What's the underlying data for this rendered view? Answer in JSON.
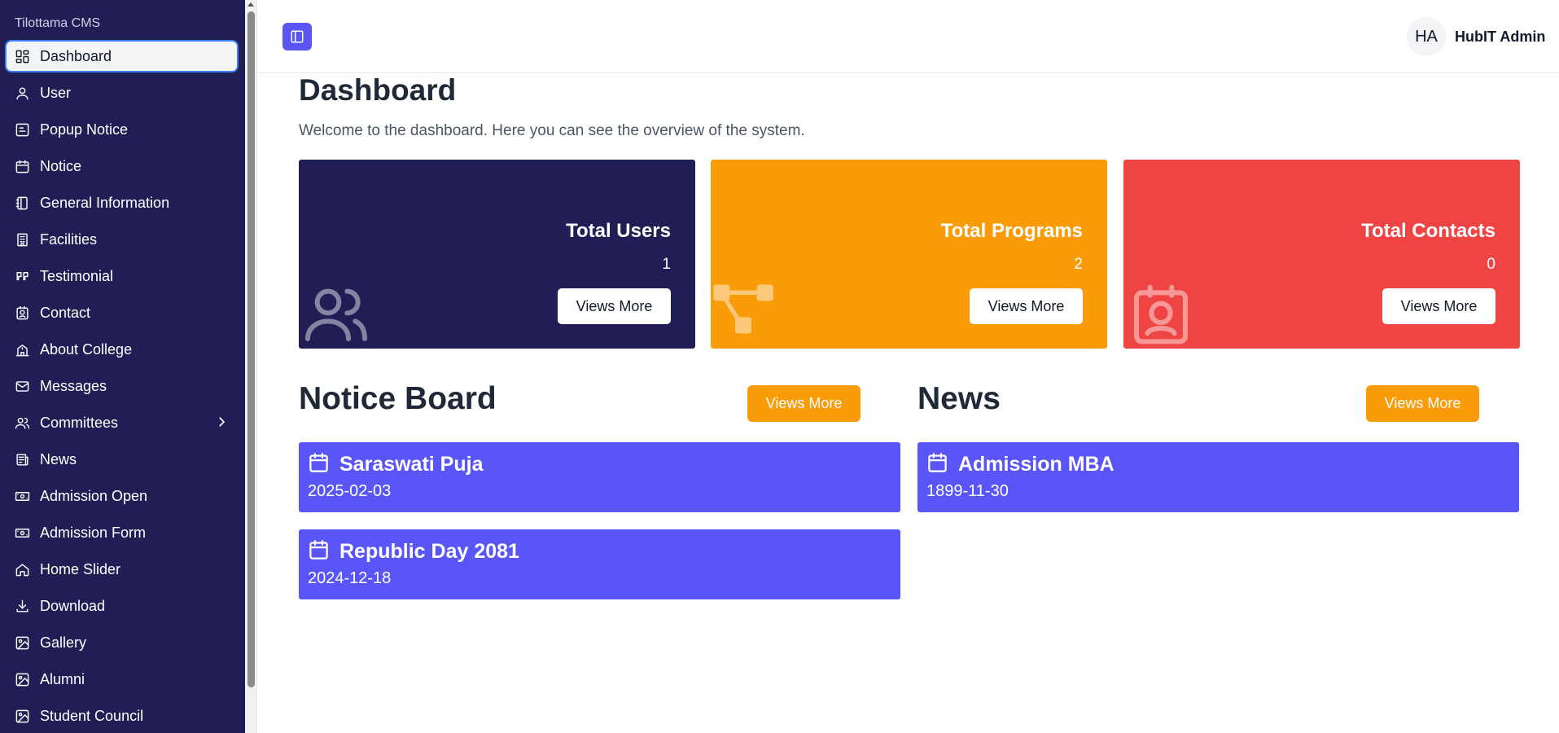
{
  "brand": "Tilottama CMS",
  "sidebar": {
    "items": [
      {
        "label": "Dashboard"
      },
      {
        "label": "User"
      },
      {
        "label": "Popup Notice"
      },
      {
        "label": "Notice"
      },
      {
        "label": "General Information"
      },
      {
        "label": "Facilities"
      },
      {
        "label": "Testimonial"
      },
      {
        "label": "Contact"
      },
      {
        "label": "About College"
      },
      {
        "label": "Messages"
      },
      {
        "label": "Committees"
      },
      {
        "label": "News"
      },
      {
        "label": "Admission Open"
      },
      {
        "label": "Admission Form"
      },
      {
        "label": "Home Slider"
      },
      {
        "label": "Download"
      },
      {
        "label": "Gallery"
      },
      {
        "label": "Alumni"
      },
      {
        "label": "Student Council"
      }
    ]
  },
  "header": {
    "avatar_initials": "HA",
    "user_name": "HubIT Admin"
  },
  "main": {
    "title": "Dashboard",
    "subtitle": "Welcome to the dashboard. Here you can see the overview of the system.",
    "cards": [
      {
        "title": "Total Users",
        "value": "1",
        "button": "Views More",
        "color": "#201e54",
        "icon": "users-icon"
      },
      {
        "title": "Total Programs",
        "value": "2",
        "button": "Views More",
        "color": "#fa9b0a",
        "icon": "workflow-icon"
      },
      {
        "title": "Total Contacts",
        "value": "0",
        "button": "Views More",
        "color": "#ef4444",
        "icon": "contact-icon"
      }
    ],
    "notice_board": {
      "title": "Notice Board",
      "button": "Views More",
      "items": [
        {
          "title": "Saraswati Puja",
          "date": "2025-02-03"
        },
        {
          "title": "Republic Day 2081",
          "date": "2024-12-18"
        }
      ]
    },
    "news": {
      "title": "News",
      "button": "Views More",
      "items": [
        {
          "title": "Admission MBA",
          "date": "1899-11-30"
        }
      ]
    }
  },
  "colors": {
    "sidebar_bg": "#201e54",
    "accent": "#5a55f7",
    "orange": "#fa9b0a",
    "red": "#ef4444"
  }
}
